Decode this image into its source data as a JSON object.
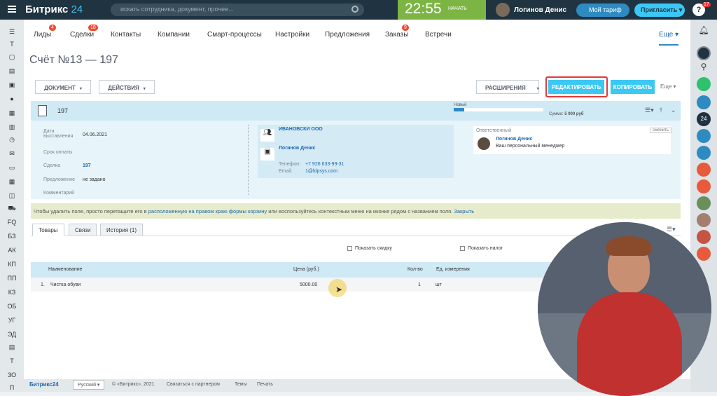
{
  "topbar": {
    "logo_main": "Битрикс",
    "logo_num": "24",
    "search_placeholder": "искать сотрудника, документ, прочее...",
    "time": "22:55",
    "start_label": "НАЧАТЬ",
    "user_name": "Логинов Денис",
    "tariff_label": "Мой тариф",
    "invite_label": "Пригласить",
    "help_label": "?",
    "help_badge": "17"
  },
  "nav": {
    "tabs": [
      {
        "label": "Лиды",
        "count": "4"
      },
      {
        "label": "Сделки",
        "count": "18"
      },
      {
        "label": "Контакты",
        "count": ""
      },
      {
        "label": "Компании",
        "count": ""
      },
      {
        "label": "Смарт-процессы",
        "count": ""
      },
      {
        "label": "Настройки",
        "count": ""
      },
      {
        "label": "Предложения",
        "count": ""
      },
      {
        "label": "Заказы",
        "count": "9"
      },
      {
        "label": "Встречи",
        "count": ""
      }
    ],
    "more_label": "Еще"
  },
  "left_sidebar": {
    "badge_top": "31",
    "abbr": [
      "FQ",
      "БЗ",
      "АК",
      "КП",
      "ПП",
      "КЗ",
      "ОБ",
      "УГ",
      "ЭД",
      "Т",
      "ЗО",
      "П"
    ],
    "letter_t": "Т"
  },
  "page": {
    "title": "Счёт №13 — 197"
  },
  "toolbar": {
    "document_label": "ДОКУМЕНТ",
    "actions_label": "ДЕЙСТВИЯ",
    "extensions_label": "РАСШИРЕНИЯ",
    "edit_label": "РЕДАКТИРОВАТЬ",
    "copy_label": "КОПИРОВАТЬ",
    "more_label": "Еще"
  },
  "card": {
    "number": "197",
    "status": "Новый",
    "progress": 0.12,
    "sum_label": "Сумма:",
    "sum_value": "5 000 руб",
    "date_label": "Дата выставления",
    "date_value": "04.06.2021",
    "due_label": "Срок оплаты",
    "deal_label": "Сделка",
    "deal_value": "197",
    "offer_label": "Предложение",
    "offer_value": "не задано",
    "comment_label": "Комментарий",
    "company": "ИВАНОВСКИ ООО",
    "contact": "Логинов Денис",
    "phone_label": "Телефон:",
    "phone_value": "+7 926 633-99-31",
    "email_label": "Email:",
    "email_value": "1@ldpsys.com",
    "responsible_label": "Ответственный",
    "change_label": "сменить",
    "responsible_name": "Логинов Денис",
    "responsible_role": "Ваш персональный менеджер"
  },
  "notice": {
    "text_1": "Чтобы удалить поле, просто перетащите его в",
    "link_1": "расположенную на правом краю формы корзину",
    "text_2": "или воспользуйтесь контекстным меню на иконке рядом с названием поля.",
    "link_2": "Закрыть"
  },
  "product_tabs": [
    "Товары",
    "Связи",
    "История (1)"
  ],
  "products": {
    "show_discount": "Показать скидку",
    "show_tax": "Показать налог",
    "col_name": "Наименование",
    "col_price": "Цена (руб.)",
    "col_qty": "Кол-во",
    "col_unit": "Ед. измерения",
    "rows": [
      {
        "n": "1.",
        "name": "Чистка обуви",
        "price": "5000.00",
        "qty": "1",
        "unit": "шт"
      }
    ]
  },
  "footer": {
    "logo": "Битрикс24",
    "lang": "Русский",
    "copyright": "© «Битрикс», 2021",
    "partner": "Связаться с партнером",
    "themes": "Темы",
    "print": "Печать"
  },
  "right_sidebar": {
    "badge_24": "24",
    "badge_1": "1"
  }
}
